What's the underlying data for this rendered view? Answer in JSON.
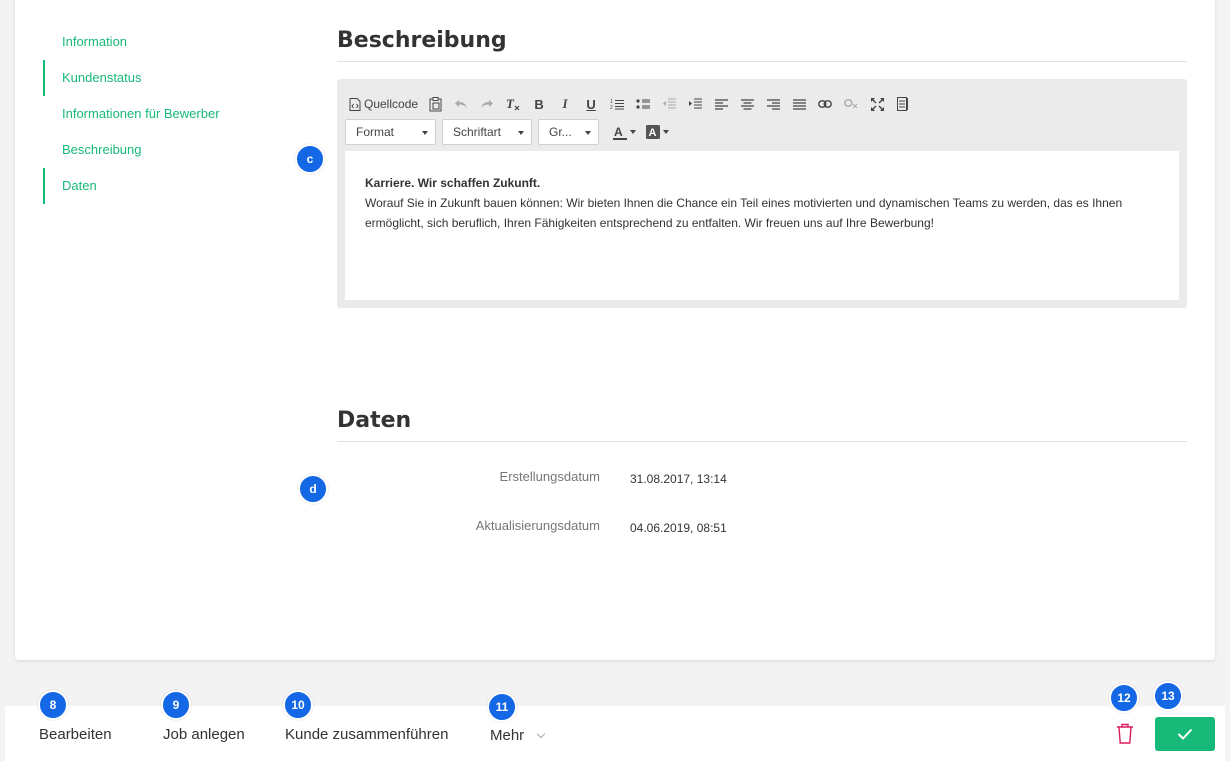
{
  "nav": {
    "items": [
      {
        "label": "Information"
      },
      {
        "label": "Kundenstatus"
      },
      {
        "label": "Informationen für Bewerber"
      },
      {
        "label": "Beschreibung"
      },
      {
        "label": "Daten"
      }
    ]
  },
  "sections": {
    "beschreibung_title": "Beschreibung",
    "daten_title": "Daten"
  },
  "editor": {
    "source_label": "Quellcode",
    "format_label": "Format",
    "font_label": "Schriftart",
    "size_label": "Gr...",
    "heading": "Karriere. Wir schaffen Zukunft.",
    "body": "Worauf Sie in Zukunft bauen können: Wir bieten Ihnen die Chance ein Teil eines motivierten und dynamischen Teams zu werden, das es Ihnen ermöglicht, sich beruflich, Ihren Fähigkeiten entsprechend zu entfalten. Wir freuen uns auf Ihre Bewerbung!"
  },
  "daten": {
    "created_label": "Erstellungsdatum",
    "created_value": "31.08.2017, 13:14",
    "updated_label": "Aktualisierungsdatum",
    "updated_value": "04.06.2019, 08:51"
  },
  "markers": {
    "c": "c",
    "d": "d",
    "m8": "8",
    "m9": "9",
    "m10": "10",
    "m11": "11",
    "m12": "12",
    "m13": "13"
  },
  "actions": {
    "edit": "Bearbeiten",
    "create_job": "Job anlegen",
    "merge": "Kunde zusammenführen",
    "more": "Mehr"
  },
  "colors": {
    "accent": "#17b978",
    "marker": "#1468e5",
    "danger": "#d81b60"
  }
}
